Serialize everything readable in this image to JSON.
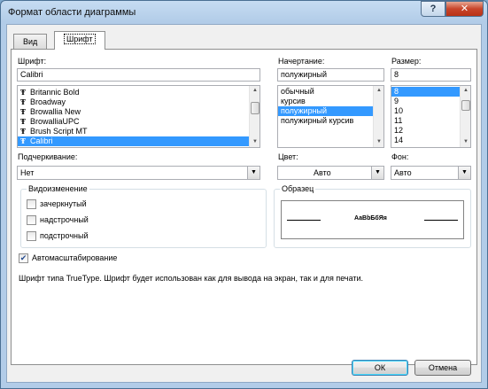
{
  "window": {
    "title": "Формат области диаграммы",
    "help_label": "?",
    "close_label": "✕"
  },
  "tabs": [
    {
      "label": "Вид"
    },
    {
      "label": "Шрифт"
    }
  ],
  "font": {
    "label": "Шрифт:",
    "value": "Calibri",
    "items": [
      {
        "label": "Britannic Bold",
        "icon": "truetype-icon"
      },
      {
        "label": "Broadway",
        "icon": "truetype-icon"
      },
      {
        "label": "Browallia New",
        "icon": "truetype-icon"
      },
      {
        "label": "BrowalliaUPC",
        "icon": "truetype-icon"
      },
      {
        "label": "Brush Script MT",
        "icon": "truetype-icon"
      },
      {
        "label": "Calibri",
        "icon": "truetype-icon",
        "selected": true
      }
    ],
    "icon_glyph": "Ŧ"
  },
  "style": {
    "label": "Начертание:",
    "value": "полужирный",
    "items": [
      {
        "label": "обычный"
      },
      {
        "label": "курсив"
      },
      {
        "label": "полужирный",
        "selected": true
      },
      {
        "label": "полужирный курсив"
      }
    ]
  },
  "size": {
    "label": "Размер:",
    "value": "8",
    "items": [
      {
        "label": "8",
        "selected": true
      },
      {
        "label": "9"
      },
      {
        "label": "10"
      },
      {
        "label": "11"
      },
      {
        "label": "12"
      },
      {
        "label": "14"
      }
    ]
  },
  "underline": {
    "label": "Подчеркивание:",
    "value": "Нет"
  },
  "color": {
    "label": "Цвет:",
    "value": "Авто"
  },
  "background": {
    "label": "Фон:",
    "value": "Авто"
  },
  "effects": {
    "title": "Видоизменение",
    "strikethrough": {
      "label": "зачеркнутый",
      "checked": false
    },
    "superscript": {
      "label": "надстрочный",
      "checked": false
    },
    "subscript": {
      "label": "подстрочный",
      "checked": false
    }
  },
  "sample": {
    "title": "Образец",
    "text": "АаВbБбЯя"
  },
  "autoscale": {
    "label": "Автомасштабирование",
    "checked": true
  },
  "info_text": "Шрифт типа TrueType. Шрифт будет использован как для вывода на экран, так и для печати.",
  "buttons": {
    "ok": "ОК",
    "cancel": "Отмена"
  },
  "glyphs": {
    "scroll_up": "▲",
    "scroll_down": "▼",
    "check": "✔"
  },
  "colors": {
    "selection": "#3399ff",
    "title_bg": "#b9d1ea",
    "close_red": "#c8452b"
  }
}
